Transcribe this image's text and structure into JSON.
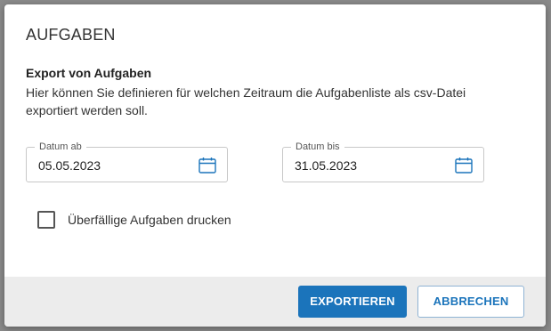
{
  "dialog": {
    "title": "AUFGABEN",
    "section_heading": "Export von Aufgaben",
    "description": "Hier können Sie definieren für welchen Zeitraum die Aufgabenliste als csv-Datei exportiert werden soll."
  },
  "date_from": {
    "label": "Datum ab",
    "value": "05.05.2023",
    "icon": "calendar-icon"
  },
  "date_to": {
    "label": "Datum bis",
    "value": "31.05.2023",
    "icon": "calendar-icon"
  },
  "overdue_checkbox": {
    "label": "Überfällige Aufgaben drucken",
    "checked": false
  },
  "buttons": {
    "export_label": "EXPORTIEREN",
    "cancel_label": "ABBRECHEN"
  },
  "colors": {
    "accent": "#1b74bb",
    "footer_bg": "#ececec",
    "icon": "#1b74bb"
  }
}
